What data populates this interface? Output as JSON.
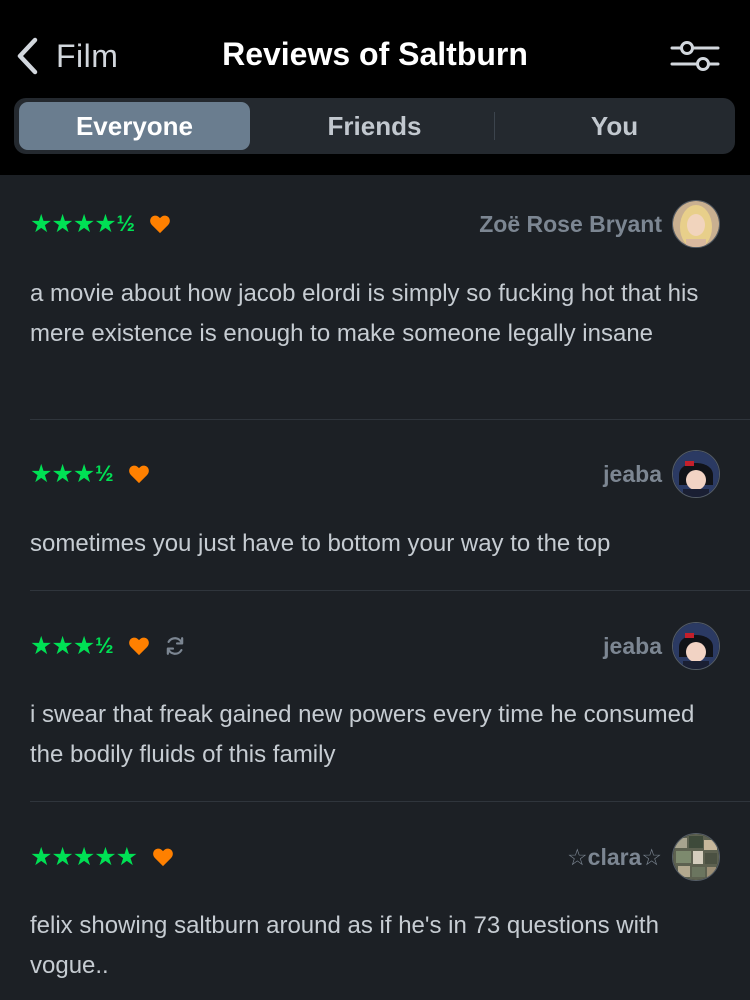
{
  "header": {
    "back_label": "Film",
    "title": "Reviews of Saltburn"
  },
  "tabs": [
    {
      "label": "Everyone",
      "active": true
    },
    {
      "label": "Friends",
      "active": false
    },
    {
      "label": "You",
      "active": false
    }
  ],
  "colors": {
    "star_green": "#00e054",
    "heart_orange": "#ff8000",
    "active_tab": "#6a7d8f"
  },
  "reviews": [
    {
      "stars": "★★★★",
      "half": "½",
      "rating": 4.5,
      "liked": true,
      "rewatch": false,
      "username": "Zoë Rose Bryant",
      "avatar": "avatar-blonde-woman",
      "text": "a movie about how jacob elordi is simply so fucking hot that his mere existence is enough to make someone legally insane"
    },
    {
      "stars": "★★★",
      "half": "½",
      "rating": 3.5,
      "liked": true,
      "rewatch": false,
      "username": "jeaba",
      "avatar": "avatar-anime-character",
      "text": "sometimes you just have to bottom your way to the top"
    },
    {
      "stars": "★★★",
      "half": "½",
      "rating": 3.5,
      "liked": true,
      "rewatch": true,
      "username": "jeaba",
      "avatar": "avatar-anime-character",
      "text": "i swear that freak gained new powers every time he consumed the bodily fluids of this family"
    },
    {
      "stars": "★★★★★",
      "half": "",
      "rating": 5,
      "liked": true,
      "rewatch": false,
      "username": "☆clara☆",
      "avatar": "avatar-collage",
      "text": "felix showing saltburn around as if he's in 73 questions with vogue.."
    }
  ]
}
